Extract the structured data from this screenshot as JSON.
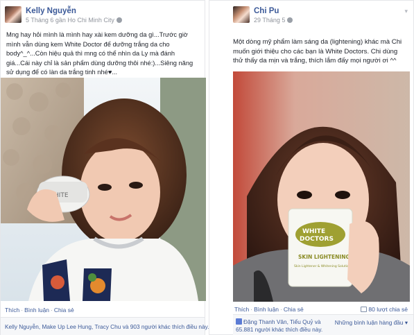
{
  "colors": {
    "link": "#3b5998",
    "meta": "#90949c",
    "border": "#e5e6e9"
  },
  "posts": [
    {
      "author": "Kelly Nguyễn",
      "meta": "5 Tháng 6 gần Ho Chi Minh City",
      "privacy_icon": "globe-icon",
      "text": "Mng hay hỏi mình là mình hay xài kem dưỡng da gì...Trước giờ mình vẫn dùng kem White Doctor để dưỡng trắng da cho body^_^...Còn hiệu quả thì mng có thể nhìn da Ly mà đánh giá...Cái này chỉ là sản phẩm dùng dưỡng thôi nhé:)...Siêng năng sử dụng để có làn da trắng tinh nhé♥...",
      "actions": {
        "like": "Thích",
        "comment": "Bình luận",
        "share": "Chia sẻ"
      },
      "likes_text": "Kelly Nguyễn, Make Up Lee Hung, Tracy Chu và 903 người khác thích điều này."
    },
    {
      "author": "Chi Pu",
      "meta": "29 Tháng 5",
      "privacy_icon": "globe-icon",
      "text": "Một dòng mỹ phẩm làm sáng da (lightening) khác mà Chi muốn giới thiệu cho các bạn là White Doctors. Chi dùng thử thấy da mịn và trắng, thích lắm đấy mọi người ơi ^^",
      "actions": {
        "like": "Thích",
        "comment": "Bình luận",
        "share": "Chia sẻ"
      },
      "shares": "80 lượt chia sẻ",
      "likes_text": "Đặng Thanh Vân, Tiểu Quỷ và 65.881 người khác thích điều này.",
      "comments_order": "Những bình luận hàng đầu ▾",
      "product": {
        "brand_line1": "WHITE",
        "brand_line2": "DOCTORS",
        "label": "SKIN LIGHTENING",
        "sub": "Skin Lightener & Whitening Solution"
      }
    }
  ]
}
